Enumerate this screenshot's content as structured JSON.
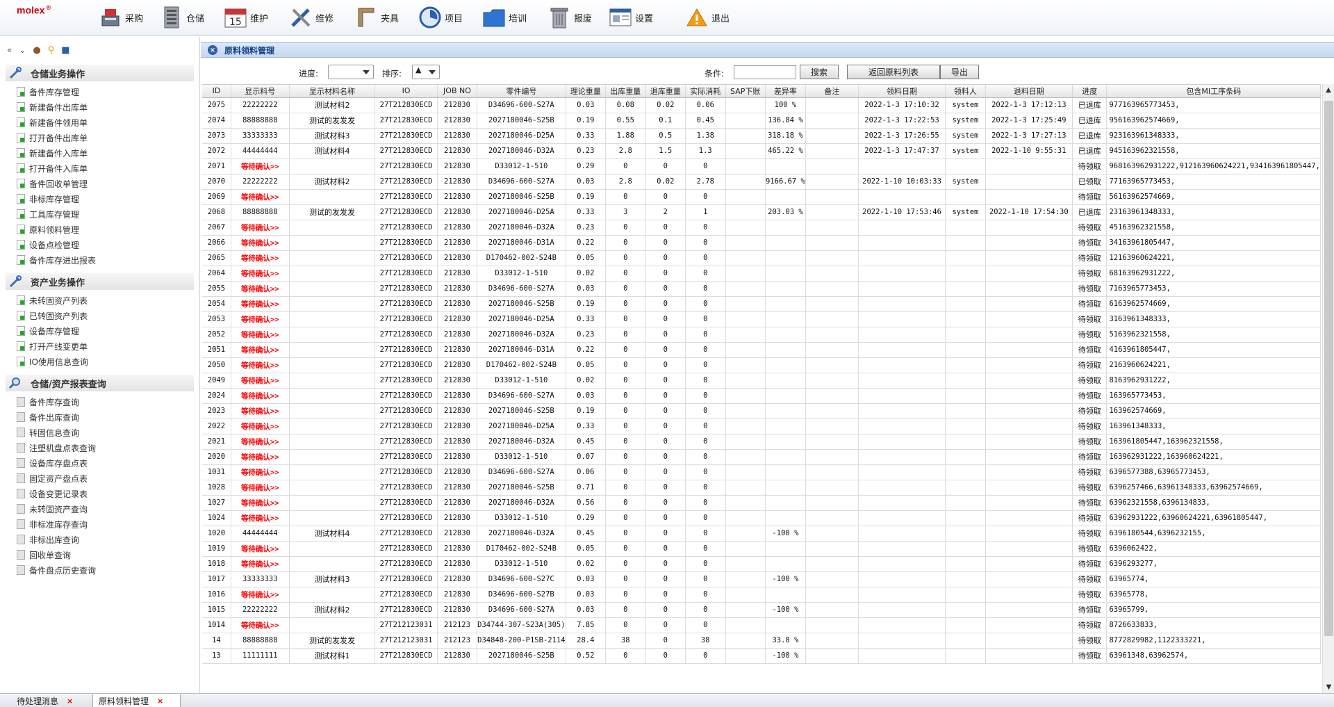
{
  "brand": {
    "logo": "molex",
    "reg": "®"
  },
  "nav": [
    {
      "label": "采购",
      "icon": "cash-register-icon"
    },
    {
      "label": "仓储",
      "icon": "server-icon"
    },
    {
      "label": "维护",
      "icon": "calendar-icon"
    },
    {
      "label": "维修",
      "icon": "tools-icon"
    },
    {
      "label": "夹具",
      "icon": "fixture-icon"
    },
    {
      "label": "项目",
      "icon": "clock-chart-icon"
    },
    {
      "label": "培训",
      "icon": "folder-icon"
    },
    {
      "label": "报废",
      "icon": "trash-icon"
    },
    {
      "label": "设置",
      "icon": "settings-window-icon"
    },
    {
      "label": "退出",
      "icon": "warning-icon"
    }
  ],
  "sidebar": {
    "sections": [
      {
        "title": "仓储业务操作",
        "items": [
          "备件库存管理",
          "新建备件出库单",
          "新建备件领用单",
          "打开备件出库单",
          "新建备件入库单",
          "打开备件入库单",
          "备件回收单管理",
          "非标库存管理",
          "工具库存管理",
          "原料领料管理",
          "设备点检管理",
          "备件库存进出报表"
        ]
      },
      {
        "title": "资产业务操作",
        "items": [
          "未转固资产列表",
          "已转固资产列表",
          "设备库存管理",
          "打开产线变更单",
          "IO使用信息查询"
        ]
      },
      {
        "title": "仓储/资产报表查询",
        "items": [
          "备件库存查询",
          "备件出库查询",
          "转固信息查询",
          "注塑机盘点表查询",
          "设备库存盘点表",
          "固定资产盘点表",
          "设备变更记录表",
          "未转固资产查询",
          "非标准库存查询",
          "非标出库查询",
          "回收单查询",
          "备件盘点历史查询"
        ]
      }
    ]
  },
  "panel": {
    "title": "原料领料管理"
  },
  "filters": {
    "progress_label": "进度:",
    "progress_value": "",
    "sort_label": "排序:",
    "sort_value": "▲",
    "condition_label": "条件:",
    "condition_value": "",
    "search": "搜索",
    "back": "返回原料列表",
    "export": "导出"
  },
  "table": {
    "columns": [
      "ID",
      "显示料号",
      "显示材料名称",
      "IO",
      "JOB NO",
      "零件编号",
      "理论重量",
      "出库重量",
      "退库重量",
      "实际消耗",
      "SAP下账",
      "差异率",
      "备注",
      "领料日期",
      "领料人",
      "退料日期",
      "进度",
      "包含MI工序条码"
    ],
    "rows": [
      [
        "2075",
        "22222222",
        "测试材料2",
        "27T212830ECD",
        "212830",
        "D34696-600-S27A",
        "0.03",
        "0.08",
        "0.02",
        "0.06",
        "",
        "100 %",
        "",
        "2022-1-3 17:10:32",
        "system",
        "2022-1-3 17:12:13",
        "已退库",
        "977163965773453,"
      ],
      [
        "2074",
        "88888888",
        "测试的发发发",
        "27T212830ECD",
        "212830",
        "2027180046-S25B",
        "0.19",
        "0.55",
        "0.1",
        "0.45",
        "",
        "136.84 %",
        "",
        "2022-1-3 17:22:53",
        "system",
        "2022-1-3 17:25:49",
        "已退库",
        "956163962574669,"
      ],
      [
        "2073",
        "33333333",
        "测试材料3",
        "27T212830ECD",
        "212830",
        "2027180046-D25A",
        "0.33",
        "1.88",
        "0.5",
        "1.38",
        "",
        "318.18 %",
        "",
        "2022-1-3 17:26:55",
        "system",
        "2022-1-3 17:27:13",
        "已退库",
        "923163961348333,"
      ],
      [
        "2072",
        "44444444",
        "测试材料4",
        "27T212830ECD",
        "212830",
        "2027180046-D32A",
        "0.23",
        "2.8",
        "1.5",
        "1.3",
        "",
        "465.22 %",
        "",
        "2022-1-3 17:47:37",
        "system",
        "2022-1-10 9:55:31",
        "已退库",
        "945163962321558,"
      ],
      [
        "2071",
        "等待确认>>",
        "",
        "27T212830ECD",
        "212830",
        "D33012-1-510",
        "0.29",
        "0",
        "0",
        "0",
        "",
        "",
        "",
        "",
        "",
        "",
        "待领取",
        "968163962931222,912163960624221,934163961805447,"
      ],
      [
        "2070",
        "22222222",
        "测试材料2",
        "27T212830ECD",
        "212830",
        "D34696-600-S27A",
        "0.03",
        "2.8",
        "0.02",
        "2.78",
        "",
        "9166.67 %",
        "",
        "2022-1-10 10:03:33",
        "system",
        "",
        "已领取",
        "77163965773453,"
      ],
      [
        "2069",
        "等待确认>>",
        "",
        "27T212830ECD",
        "212830",
        "2027180046-S25B",
        "0.19",
        "0",
        "0",
        "0",
        "",
        "",
        "",
        "",
        "",
        "",
        "待领取",
        "56163962574669,"
      ],
      [
        "2068",
        "88888888",
        "测试的发发发",
        "27T212830ECD",
        "212830",
        "2027180046-D25A",
        "0.33",
        "3",
        "2",
        "1",
        "",
        "203.03 %",
        "",
        "2022-1-10 17:53:46",
        "system",
        "2022-1-10 17:54:30",
        "已退库",
        "23163961348333,"
      ],
      [
        "2067",
        "等待确认>>",
        "",
        "27T212830ECD",
        "212830",
        "2027180046-D32A",
        "0.23",
        "0",
        "0",
        "0",
        "",
        "",
        "",
        "",
        "",
        "",
        "待领取",
        "45163962321558,"
      ],
      [
        "2066",
        "等待确认>>",
        "",
        "27T212830ECD",
        "212830",
        "2027180046-D31A",
        "0.22",
        "0",
        "0",
        "0",
        "",
        "",
        "",
        "",
        "",
        "",
        "待领取",
        "34163961805447,"
      ],
      [
        "2065",
        "等待确认>>",
        "",
        "27T212830ECD",
        "212830",
        "D170462-002-S24B",
        "0.05",
        "0",
        "0",
        "0",
        "",
        "",
        "",
        "",
        "",
        "",
        "待领取",
        "12163960624221,"
      ],
      [
        "2064",
        "等待确认>>",
        "",
        "27T212830ECD",
        "212830",
        "D33012-1-510",
        "0.02",
        "0",
        "0",
        "0",
        "",
        "",
        "",
        "",
        "",
        "",
        "待领取",
        "68163962931222,"
      ],
      [
        "2055",
        "等待确认>>",
        "",
        "27T212830ECD",
        "212830",
        "D34696-600-S27A",
        "0.03",
        "0",
        "0",
        "0",
        "",
        "",
        "",
        "",
        "",
        "",
        "待领取",
        "7163965773453,"
      ],
      [
        "2054",
        "等待确认>>",
        "",
        "27T212830ECD",
        "212830",
        "2027180046-S25B",
        "0.19",
        "0",
        "0",
        "0",
        "",
        "",
        "",
        "",
        "",
        "",
        "待领取",
        "6163962574669,"
      ],
      [
        "2053",
        "等待确认>>",
        "",
        "27T212830ECD",
        "212830",
        "2027180046-D25A",
        "0.33",
        "0",
        "0",
        "0",
        "",
        "",
        "",
        "",
        "",
        "",
        "待领取",
        "3163961348333,"
      ],
      [
        "2052",
        "等待确认>>",
        "",
        "27T212830ECD",
        "212830",
        "2027180046-D32A",
        "0.23",
        "0",
        "0",
        "0",
        "",
        "",
        "",
        "",
        "",
        "",
        "待领取",
        "5163962321558,"
      ],
      [
        "2051",
        "等待确认>>",
        "",
        "27T212830ECD",
        "212830",
        "2027180046-D31A",
        "0.22",
        "0",
        "0",
        "0",
        "",
        "",
        "",
        "",
        "",
        "",
        "待领取",
        "4163961805447,"
      ],
      [
        "2050",
        "等待确认>>",
        "",
        "27T212830ECD",
        "212830",
        "D170462-002-S24B",
        "0.05",
        "0",
        "0",
        "0",
        "",
        "",
        "",
        "",
        "",
        "",
        "待领取",
        "2163960624221,"
      ],
      [
        "2049",
        "等待确认>>",
        "",
        "27T212830ECD",
        "212830",
        "D33012-1-510",
        "0.02",
        "0",
        "0",
        "0",
        "",
        "",
        "",
        "",
        "",
        "",
        "待领取",
        "8163962931222,"
      ],
      [
        "2024",
        "等待确认>>",
        "",
        "27T212830ECD",
        "212830",
        "D34696-600-S27A",
        "0.03",
        "0",
        "0",
        "0",
        "",
        "",
        "",
        "",
        "",
        "",
        "待领取",
        "163965773453,"
      ],
      [
        "2023",
        "等待确认>>",
        "",
        "27T212830ECD",
        "212830",
        "2027180046-S25B",
        "0.19",
        "0",
        "0",
        "0",
        "",
        "",
        "",
        "",
        "",
        "",
        "待领取",
        "163962574669,"
      ],
      [
        "2022",
        "等待确认>>",
        "",
        "27T212830ECD",
        "212830",
        "2027180046-D25A",
        "0.33",
        "0",
        "0",
        "0",
        "",
        "",
        "",
        "",
        "",
        "",
        "待领取",
        "163961348333,"
      ],
      [
        "2021",
        "等待确认>>",
        "",
        "27T212830ECD",
        "212830",
        "2027180046-D32A",
        "0.45",
        "0",
        "0",
        "0",
        "",
        "",
        "",
        "",
        "",
        "",
        "待领取",
        "163961805447,163962321558,"
      ],
      [
        "2020",
        "等待确认>>",
        "",
        "27T212830ECD",
        "212830",
        "D33012-1-510",
        "0.07",
        "0",
        "0",
        "0",
        "",
        "",
        "",
        "",
        "",
        "",
        "待领取",
        "163962931222,163960624221,"
      ],
      [
        "1031",
        "等待确认>>",
        "",
        "27T212830ECD",
        "212830",
        "D34696-600-S27A",
        "0.06",
        "0",
        "0",
        "0",
        "",
        "",
        "",
        "",
        "",
        "",
        "待领取",
        "6396577388,63965773453,"
      ],
      [
        "1028",
        "等待确认>>",
        "",
        "27T212830ECD",
        "212830",
        "2027180046-S25B",
        "0.71",
        "0",
        "0",
        "0",
        "",
        "",
        "",
        "",
        "",
        "",
        "待领取",
        "6396257466,63961348333,63962574669,"
      ],
      [
        "1027",
        "等待确认>>",
        "",
        "27T212830ECD",
        "212830",
        "2027180046-D32A",
        "0.56",
        "0",
        "0",
        "0",
        "",
        "",
        "",
        "",
        "",
        "",
        "待领取",
        "63962321558,6396134833,"
      ],
      [
        "1024",
        "等待确认>>",
        "",
        "27T212830ECD",
        "212830",
        "D33012-1-510",
        "0.29",
        "0",
        "0",
        "0",
        "",
        "",
        "",
        "",
        "",
        "",
        "待领取",
        "63962931222,63960624221,63961805447,"
      ],
      [
        "1020",
        "44444444",
        "测试材料4",
        "27T212830ECD",
        "212830",
        "2027180046-D32A",
        "0.45",
        "0",
        "0",
        "0",
        "",
        "-100 %",
        "",
        "",
        "",
        "",
        "待领取",
        "6396180544,6396232155,"
      ],
      [
        "1019",
        "等待确认>>",
        "",
        "27T212830ECD",
        "212830",
        "D170462-002-S24B",
        "0.05",
        "0",
        "0",
        "0",
        "",
        "",
        "",
        "",
        "",
        "",
        "待领取",
        "6396062422,"
      ],
      [
        "1018",
        "等待确认>>",
        "",
        "27T212830ECD",
        "212830",
        "D33012-1-510",
        "0.02",
        "0",
        "0",
        "0",
        "",
        "",
        "",
        "",
        "",
        "",
        "待领取",
        "6396293277,"
      ],
      [
        "1017",
        "33333333",
        "测试材料3",
        "27T212830ECD",
        "212830",
        "D34696-600-S27C",
        "0.03",
        "0",
        "0",
        "0",
        "",
        "-100 %",
        "",
        "",
        "",
        "",
        "待领取",
        "63965774,"
      ],
      [
        "1016",
        "等待确认>>",
        "",
        "27T212830ECD",
        "212830",
        "D34696-600-S27B",
        "0.03",
        "0",
        "0",
        "0",
        "",
        "",
        "",
        "",
        "",
        "",
        "待领取",
        "63965778,"
      ],
      [
        "1015",
        "22222222",
        "测试材料2",
        "27T212830ECD",
        "212830",
        "D34696-600-S27A",
        "0.03",
        "0",
        "0",
        "0",
        "",
        "-100 %",
        "",
        "",
        "",
        "",
        "待领取",
        "63965799,"
      ],
      [
        "1014",
        "等待确认>>",
        "",
        "27T212123031",
        "212123",
        "D34744-307-S23A(305)",
        "7.85",
        "0",
        "0",
        "0",
        "",
        "",
        "",
        "",
        "",
        "",
        "待领取",
        "8726633833,"
      ],
      [
        "14",
        "88888888",
        "测试的发发发",
        "27T212123031",
        "212123",
        "D34848-200-P1SB-2114",
        "28.4",
        "38",
        "0",
        "38",
        "",
        "33.8 %",
        "",
        "",
        "",
        "",
        "待领取",
        "8772829982,1122333221,"
      ],
      [
        "13",
        "11111111",
        "测试材料1",
        "27T212830ECD",
        "212830",
        "2027180046-S25B",
        "0.52",
        "0",
        "0",
        "0",
        "",
        "-100 %",
        "",
        "",
        "",
        "",
        "待领取",
        "63961348,63962574,"
      ]
    ]
  },
  "tabs": [
    {
      "label": "待处理消息",
      "close": "×"
    },
    {
      "label": "原料领料管理",
      "close": "×"
    }
  ]
}
